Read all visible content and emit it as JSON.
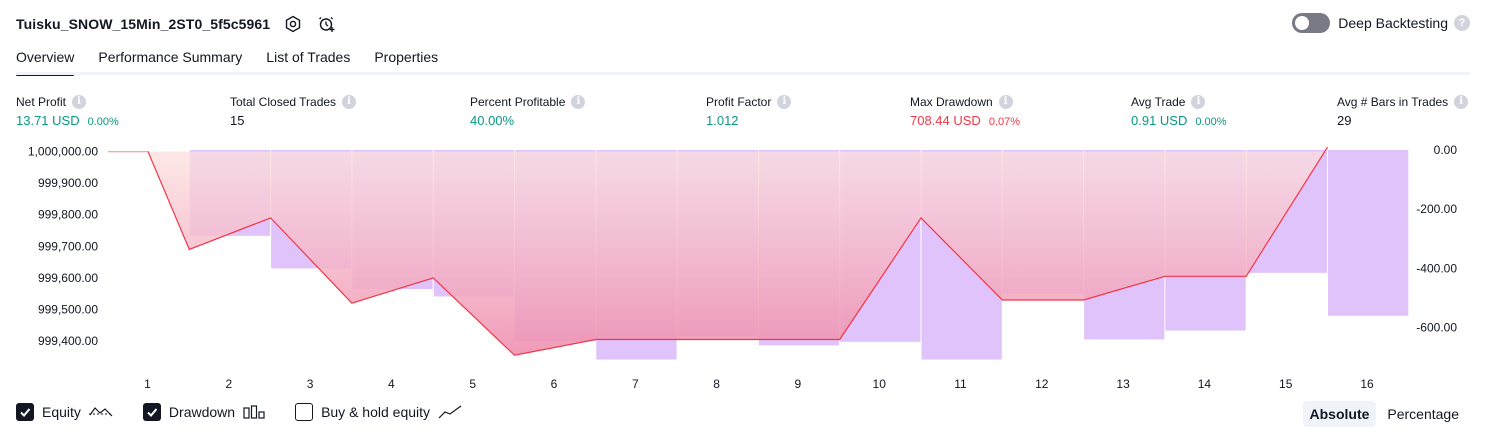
{
  "strategy_name": "Tuisku_SNOW_15Min_2ST0_5f5c5961",
  "deep_backtesting_label": "Deep Backtesting",
  "tabs": [
    {
      "label": "Overview",
      "active": true
    },
    {
      "label": "Performance Summary",
      "active": false
    },
    {
      "label": "List of Trades",
      "active": false
    },
    {
      "label": "Properties",
      "active": false
    }
  ],
  "stats": {
    "net_profit": {
      "label": "Net Profit",
      "value": "13.71 USD",
      "sub": "0.00%"
    },
    "total_closed_trades": {
      "label": "Total Closed Trades",
      "value": "15"
    },
    "percent_profitable": {
      "label": "Percent Profitable",
      "value": "40.00%"
    },
    "profit_factor": {
      "label": "Profit Factor",
      "value": "1.012"
    },
    "max_drawdown": {
      "label": "Max Drawdown",
      "value": "708.44 USD",
      "sub": "0.07%"
    },
    "avg_trade": {
      "label": "Avg Trade",
      "value": "0.91 USD",
      "sub": "0.00%"
    },
    "avg_bars": {
      "label": "Avg # Bars in Trades",
      "value": "29"
    }
  },
  "colors": {
    "green": "#089981",
    "red": "#f23645",
    "drawdown_bar": "#e1c3fb",
    "equity_line": "#f23645",
    "equity_fill_top": "#fde2e0",
    "equity_fill_bottom": "#ee8fb0"
  },
  "legend": {
    "equity": {
      "label": "Equity",
      "checked": true
    },
    "drawdown": {
      "label": "Drawdown",
      "checked": true
    },
    "buy_hold": {
      "label": "Buy & hold equity",
      "checked": false
    }
  },
  "mode": {
    "absolute": "Absolute",
    "percentage": "Percentage",
    "active": "absolute"
  },
  "chart_data": {
    "type": "line",
    "x": [
      0,
      1,
      2,
      3,
      4,
      5,
      6,
      7,
      8,
      9,
      10,
      11,
      12,
      13,
      14,
      15,
      16
    ],
    "x_tick_labels": [
      "1",
      "2",
      "3",
      "4",
      "5",
      "6",
      "7",
      "8",
      "9",
      "10",
      "11",
      "12",
      "13",
      "14",
      "15",
      "16"
    ],
    "left_axis": {
      "ticks": [
        "1,000,000.00",
        "999,900.00",
        "999,800.00",
        "999,700.00",
        "999,600.00",
        "999,500.00",
        "999,400.00"
      ],
      "tick_values": [
        1000000,
        999900,
        999800,
        999700,
        999600,
        999500,
        999400
      ],
      "range": [
        999340,
        1000005
      ]
    },
    "right_axis": {
      "ticks": [
        "0.00",
        "-200.00",
        "-400.00",
        "-600.00"
      ],
      "tick_values": [
        0,
        -200,
        -400,
        -600
      ],
      "range": [
        -708.44,
        0
      ]
    },
    "series": [
      {
        "name": "Equity",
        "axis": "left",
        "values": [
          1000000,
          999690,
          999790,
          999520,
          999600,
          999355,
          999405,
          999405,
          999405,
          999405,
          999790,
          999530,
          999530,
          999605,
          999605,
          1000014
        ]
      },
      {
        "name": "Drawdown",
        "type": "bar",
        "axis": "right",
        "values": [
          0,
          -290,
          -400,
          -470,
          -495,
          -645,
          -708,
          -628,
          -660,
          -648,
          -708,
          -485,
          -640,
          -610,
          -415,
          -560
        ]
      }
    ],
    "grid": false
  }
}
